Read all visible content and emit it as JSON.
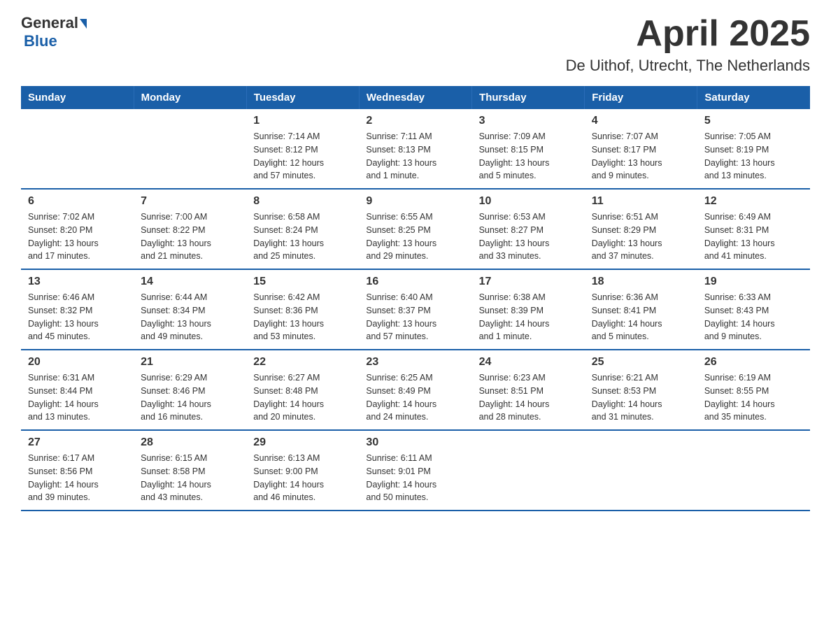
{
  "header": {
    "logo_general": "General",
    "logo_blue": "Blue",
    "month_title": "April 2025",
    "location": "De Uithof, Utrecht, The Netherlands"
  },
  "weekdays": [
    "Sunday",
    "Monday",
    "Tuesday",
    "Wednesday",
    "Thursday",
    "Friday",
    "Saturday"
  ],
  "weeks": [
    [
      {
        "day": "",
        "info": ""
      },
      {
        "day": "",
        "info": ""
      },
      {
        "day": "1",
        "info": "Sunrise: 7:14 AM\nSunset: 8:12 PM\nDaylight: 12 hours\nand 57 minutes."
      },
      {
        "day": "2",
        "info": "Sunrise: 7:11 AM\nSunset: 8:13 PM\nDaylight: 13 hours\nand 1 minute."
      },
      {
        "day": "3",
        "info": "Sunrise: 7:09 AM\nSunset: 8:15 PM\nDaylight: 13 hours\nand 5 minutes."
      },
      {
        "day": "4",
        "info": "Sunrise: 7:07 AM\nSunset: 8:17 PM\nDaylight: 13 hours\nand 9 minutes."
      },
      {
        "day": "5",
        "info": "Sunrise: 7:05 AM\nSunset: 8:19 PM\nDaylight: 13 hours\nand 13 minutes."
      }
    ],
    [
      {
        "day": "6",
        "info": "Sunrise: 7:02 AM\nSunset: 8:20 PM\nDaylight: 13 hours\nand 17 minutes."
      },
      {
        "day": "7",
        "info": "Sunrise: 7:00 AM\nSunset: 8:22 PM\nDaylight: 13 hours\nand 21 minutes."
      },
      {
        "day": "8",
        "info": "Sunrise: 6:58 AM\nSunset: 8:24 PM\nDaylight: 13 hours\nand 25 minutes."
      },
      {
        "day": "9",
        "info": "Sunrise: 6:55 AM\nSunset: 8:25 PM\nDaylight: 13 hours\nand 29 minutes."
      },
      {
        "day": "10",
        "info": "Sunrise: 6:53 AM\nSunset: 8:27 PM\nDaylight: 13 hours\nand 33 minutes."
      },
      {
        "day": "11",
        "info": "Sunrise: 6:51 AM\nSunset: 8:29 PM\nDaylight: 13 hours\nand 37 minutes."
      },
      {
        "day": "12",
        "info": "Sunrise: 6:49 AM\nSunset: 8:31 PM\nDaylight: 13 hours\nand 41 minutes."
      }
    ],
    [
      {
        "day": "13",
        "info": "Sunrise: 6:46 AM\nSunset: 8:32 PM\nDaylight: 13 hours\nand 45 minutes."
      },
      {
        "day": "14",
        "info": "Sunrise: 6:44 AM\nSunset: 8:34 PM\nDaylight: 13 hours\nand 49 minutes."
      },
      {
        "day": "15",
        "info": "Sunrise: 6:42 AM\nSunset: 8:36 PM\nDaylight: 13 hours\nand 53 minutes."
      },
      {
        "day": "16",
        "info": "Sunrise: 6:40 AM\nSunset: 8:37 PM\nDaylight: 13 hours\nand 57 minutes."
      },
      {
        "day": "17",
        "info": "Sunrise: 6:38 AM\nSunset: 8:39 PM\nDaylight: 14 hours\nand 1 minute."
      },
      {
        "day": "18",
        "info": "Sunrise: 6:36 AM\nSunset: 8:41 PM\nDaylight: 14 hours\nand 5 minutes."
      },
      {
        "day": "19",
        "info": "Sunrise: 6:33 AM\nSunset: 8:43 PM\nDaylight: 14 hours\nand 9 minutes."
      }
    ],
    [
      {
        "day": "20",
        "info": "Sunrise: 6:31 AM\nSunset: 8:44 PM\nDaylight: 14 hours\nand 13 minutes."
      },
      {
        "day": "21",
        "info": "Sunrise: 6:29 AM\nSunset: 8:46 PM\nDaylight: 14 hours\nand 16 minutes."
      },
      {
        "day": "22",
        "info": "Sunrise: 6:27 AM\nSunset: 8:48 PM\nDaylight: 14 hours\nand 20 minutes."
      },
      {
        "day": "23",
        "info": "Sunrise: 6:25 AM\nSunset: 8:49 PM\nDaylight: 14 hours\nand 24 minutes."
      },
      {
        "day": "24",
        "info": "Sunrise: 6:23 AM\nSunset: 8:51 PM\nDaylight: 14 hours\nand 28 minutes."
      },
      {
        "day": "25",
        "info": "Sunrise: 6:21 AM\nSunset: 8:53 PM\nDaylight: 14 hours\nand 31 minutes."
      },
      {
        "day": "26",
        "info": "Sunrise: 6:19 AM\nSunset: 8:55 PM\nDaylight: 14 hours\nand 35 minutes."
      }
    ],
    [
      {
        "day": "27",
        "info": "Sunrise: 6:17 AM\nSunset: 8:56 PM\nDaylight: 14 hours\nand 39 minutes."
      },
      {
        "day": "28",
        "info": "Sunrise: 6:15 AM\nSunset: 8:58 PM\nDaylight: 14 hours\nand 43 minutes."
      },
      {
        "day": "29",
        "info": "Sunrise: 6:13 AM\nSunset: 9:00 PM\nDaylight: 14 hours\nand 46 minutes."
      },
      {
        "day": "30",
        "info": "Sunrise: 6:11 AM\nSunset: 9:01 PM\nDaylight: 14 hours\nand 50 minutes."
      },
      {
        "day": "",
        "info": ""
      },
      {
        "day": "",
        "info": ""
      },
      {
        "day": "",
        "info": ""
      }
    ]
  ]
}
